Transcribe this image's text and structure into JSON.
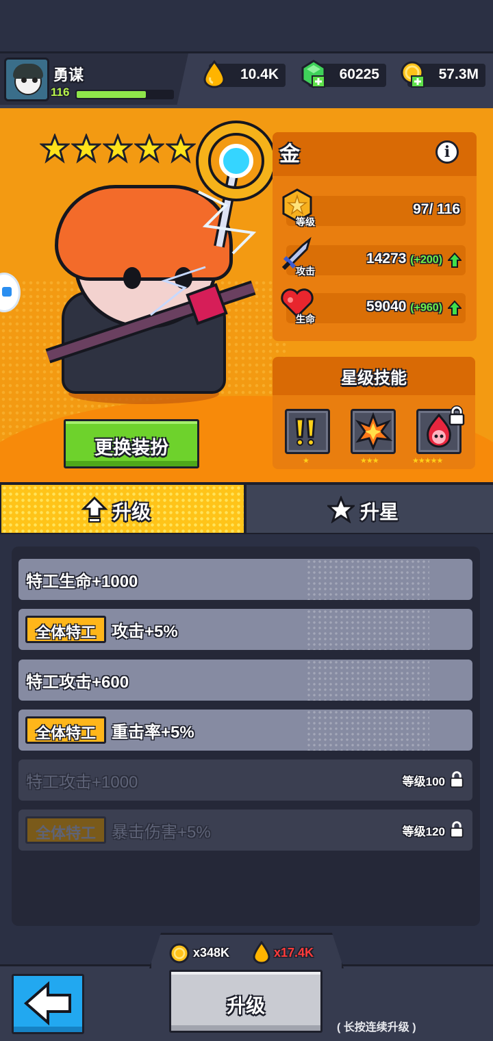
{
  "player": {
    "name": "勇谋",
    "level": "116",
    "xp_fraction": 0.72
  },
  "resources": {
    "elixir": "10.4K",
    "gems": "60225",
    "gold": "57.3M"
  },
  "hero": {
    "stars": 5,
    "rarity": "金",
    "stats": {
      "level": {
        "label": "等级",
        "value": "97/ 116"
      },
      "attack": {
        "label": "攻击",
        "value": "14273",
        "bonus": "(+200)"
      },
      "hp": {
        "label": "生命",
        "value": "59040",
        "bonus": "(+960)"
      }
    },
    "skills_title": "星级技能",
    "skills": [
      {
        "name": "alert-skill-icon",
        "stars": "★"
      },
      {
        "name": "explosion-skill-icon",
        "stars": "★★★"
      },
      {
        "name": "flame-skull-skill-icon",
        "stars": "★★★★★",
        "locked": true
      }
    ],
    "outfit_button": "更换装扮"
  },
  "tabs": {
    "upgrade": "升级",
    "star": "升星"
  },
  "upgrades": [
    {
      "text": "特工生命+1000",
      "tag": "",
      "locked": false,
      "req": ""
    },
    {
      "text": "攻击+5%",
      "tag": "全体特工",
      "locked": false,
      "req": ""
    },
    {
      "text": "特工攻击+600",
      "tag": "",
      "locked": false,
      "req": ""
    },
    {
      "text": "重击率+5%",
      "tag": "全体特工",
      "locked": false,
      "req": ""
    },
    {
      "text": "特工攻击+1000",
      "tag": "",
      "locked": true,
      "req": "等级100"
    },
    {
      "text": "暴击伤害+5%",
      "tag": "全体特工",
      "locked": true,
      "req": "等级120"
    }
  ],
  "cost": {
    "gold": "x348K",
    "elixir": "x17.4K"
  },
  "colors": {
    "elixir_cost": "#ff3b3b",
    "bonus_green": "#6ef04a",
    "tab_active": "#ffc419"
  },
  "upgrade_button": "升级",
  "hold_hint": "( 长按连续升级 )"
}
